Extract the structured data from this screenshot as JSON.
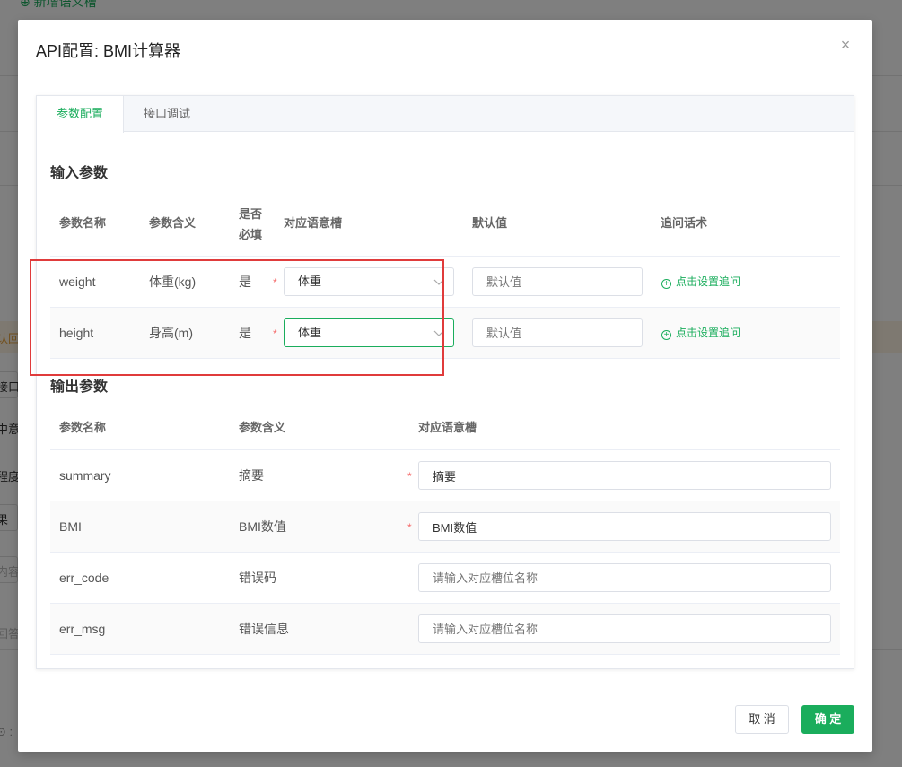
{
  "background": {
    "top_link": "⊕ 新增语义槽",
    "side_labels": [
      "认回",
      "接口",
      "中意",
      "程度",
      "果",
      "内容",
      "回答",
      "⊙ :"
    ]
  },
  "modal": {
    "title": "API配置: BMI计算器",
    "close_icon": "×",
    "tabs": [
      {
        "label": "参数配置",
        "active": true
      },
      {
        "label": "接口调试",
        "active": false
      }
    ],
    "input_section": {
      "title": "输入参数",
      "headers": {
        "name": "参数名称",
        "meaning": "参数含义",
        "required_line1": "是否",
        "required_line2": "必填",
        "slot": "对应语意槽",
        "default": "默认值",
        "followup": "追问话术"
      },
      "rows": [
        {
          "name": "weight",
          "meaning": "体重(kg)",
          "required": "是",
          "required_mark": "*",
          "slot_value": "体重",
          "default_placeholder": "默认值",
          "followup_link": "点击设置追问"
        },
        {
          "name": "height",
          "meaning": "身高(m)",
          "required": "是",
          "required_mark": "*",
          "slot_value": "体重",
          "default_placeholder": "默认值",
          "followup_link": "点击设置追问"
        }
      ]
    },
    "output_section": {
      "title": "输出参数",
      "headers": {
        "name": "参数名称",
        "meaning": "参数含义",
        "slot": "对应语意槽"
      },
      "rows": [
        {
          "name": "summary",
          "meaning": "摘要",
          "required_mark": "*",
          "slot_value": "摘要",
          "placeholder": ""
        },
        {
          "name": "BMI",
          "meaning": "BMI数值",
          "required_mark": "*",
          "slot_value": "BMI数值",
          "placeholder": ""
        },
        {
          "name": "err_code",
          "meaning": "错误码",
          "required_mark": "",
          "slot_value": "",
          "placeholder": "请输入对应槽位名称"
        },
        {
          "name": "err_msg",
          "meaning": "错误信息",
          "required_mark": "",
          "slot_value": "",
          "placeholder": "请输入对应槽位名称"
        }
      ]
    },
    "footer": {
      "cancel_label": "取 消",
      "confirm_label": "确 定"
    }
  },
  "colors": {
    "accent": "#1aad5c",
    "highlight_box": "#e03b3b",
    "required": "#f56c6c"
  }
}
